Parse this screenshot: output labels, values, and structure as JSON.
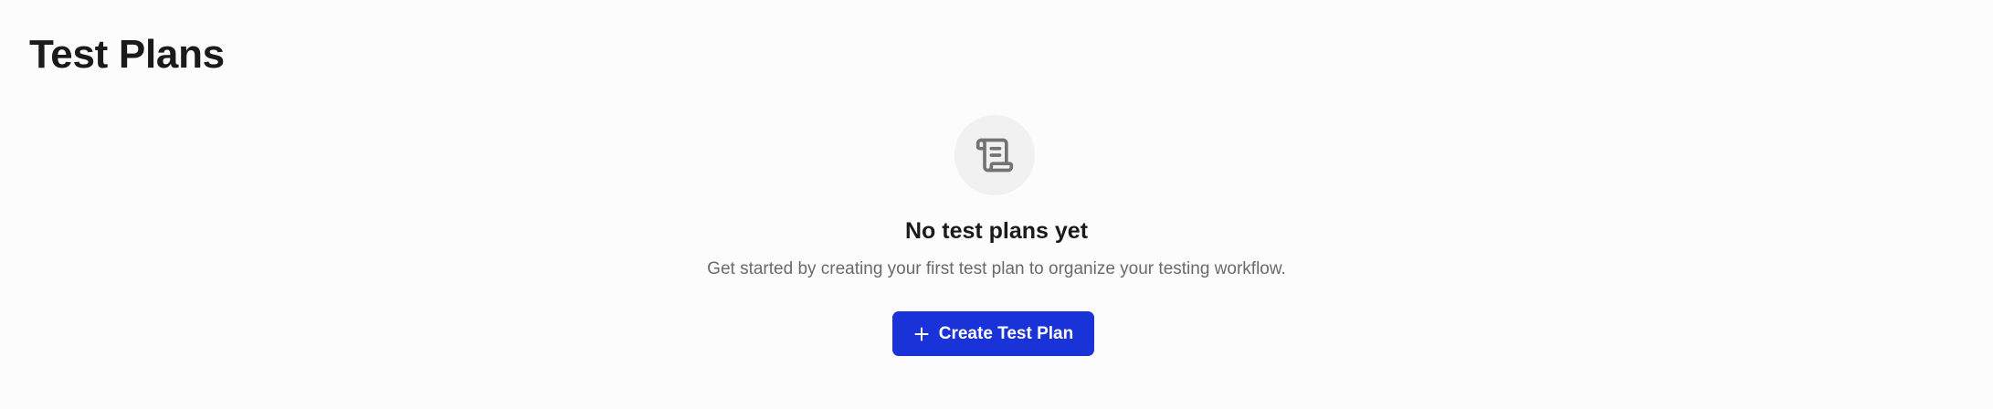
{
  "page": {
    "title": "Test Plans"
  },
  "empty_state": {
    "icon": "scroll-icon",
    "heading": "No test plans yet",
    "description": "Get started by creating your first test plan to organize your testing workflow.",
    "button": {
      "icon": "plus-icon",
      "label": "Create Test Plan"
    }
  },
  "colors": {
    "background": "#fcfcfc",
    "primary_button": "#1a33d8",
    "icon_circle": "#f1f1f1",
    "icon_stroke": "#737373",
    "heading": "#1a1a1a",
    "description": "#6a6a6a"
  }
}
